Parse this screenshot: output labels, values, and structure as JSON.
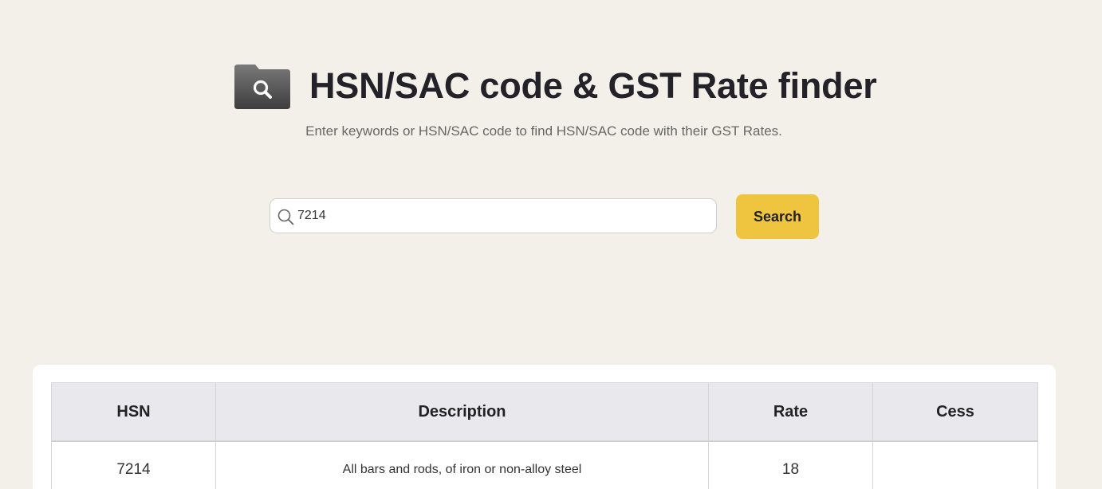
{
  "header": {
    "title": "HSN/SAC code & GST Rate finder",
    "subtitle": "Enter keywords or HSN/SAC code to find HSN/SAC code with their GST Rates.",
    "logo_icon": "folder-search-icon"
  },
  "search": {
    "value": "7214",
    "icon": "search-icon",
    "button_label": "Search",
    "button_color": "#efc53f"
  },
  "table": {
    "columns": [
      "HSN",
      "Description",
      "Rate",
      "Cess"
    ],
    "rows": [
      {
        "hsn": "7214",
        "description": "All bars and rods, of iron or non-alloy steel",
        "rate": "18",
        "cess": ""
      }
    ]
  }
}
